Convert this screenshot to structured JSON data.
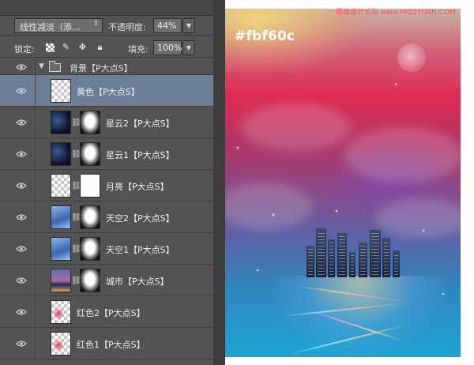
{
  "options_bar": {
    "blend_mode": "线性减淡（添…",
    "opacity_label": "不透明度:",
    "opacity_value": "44%",
    "lock_label": "锁定:",
    "fill_label": "填充:",
    "fill_value": "100%"
  },
  "group": {
    "name": "背景【P大点S】"
  },
  "layers": [
    {
      "name": "黄色【P大点S】",
      "selected": true,
      "thumb": "checker",
      "mask": false
    },
    {
      "name": "星云2【P大点S】",
      "selected": false,
      "thumb": "nebula",
      "mask": true
    },
    {
      "name": "星云1【P大点S】",
      "selected": false,
      "thumb": "nebula",
      "mask": true
    },
    {
      "name": "月亮【P大点S】",
      "selected": false,
      "thumb": "checker",
      "mask": true
    },
    {
      "name": "天空2【P大点S】",
      "selected": false,
      "thumb": "sky",
      "mask": true
    },
    {
      "name": "天空1【P大点S】",
      "selected": false,
      "thumb": "sky",
      "mask": true
    },
    {
      "name": "城市【P大点S】",
      "selected": false,
      "thumb": "city",
      "mask": true
    },
    {
      "name": "红色2【P大点S】",
      "selected": false,
      "thumb": "red",
      "mask": false
    },
    {
      "name": "红色1【P大点S】",
      "selected": false,
      "thumb": "red",
      "mask": false
    }
  ],
  "canvas": {
    "color_label": "#fbf60c"
  },
  "watermark": "思缘设计论坛 www.MISSYUAN.COM"
}
